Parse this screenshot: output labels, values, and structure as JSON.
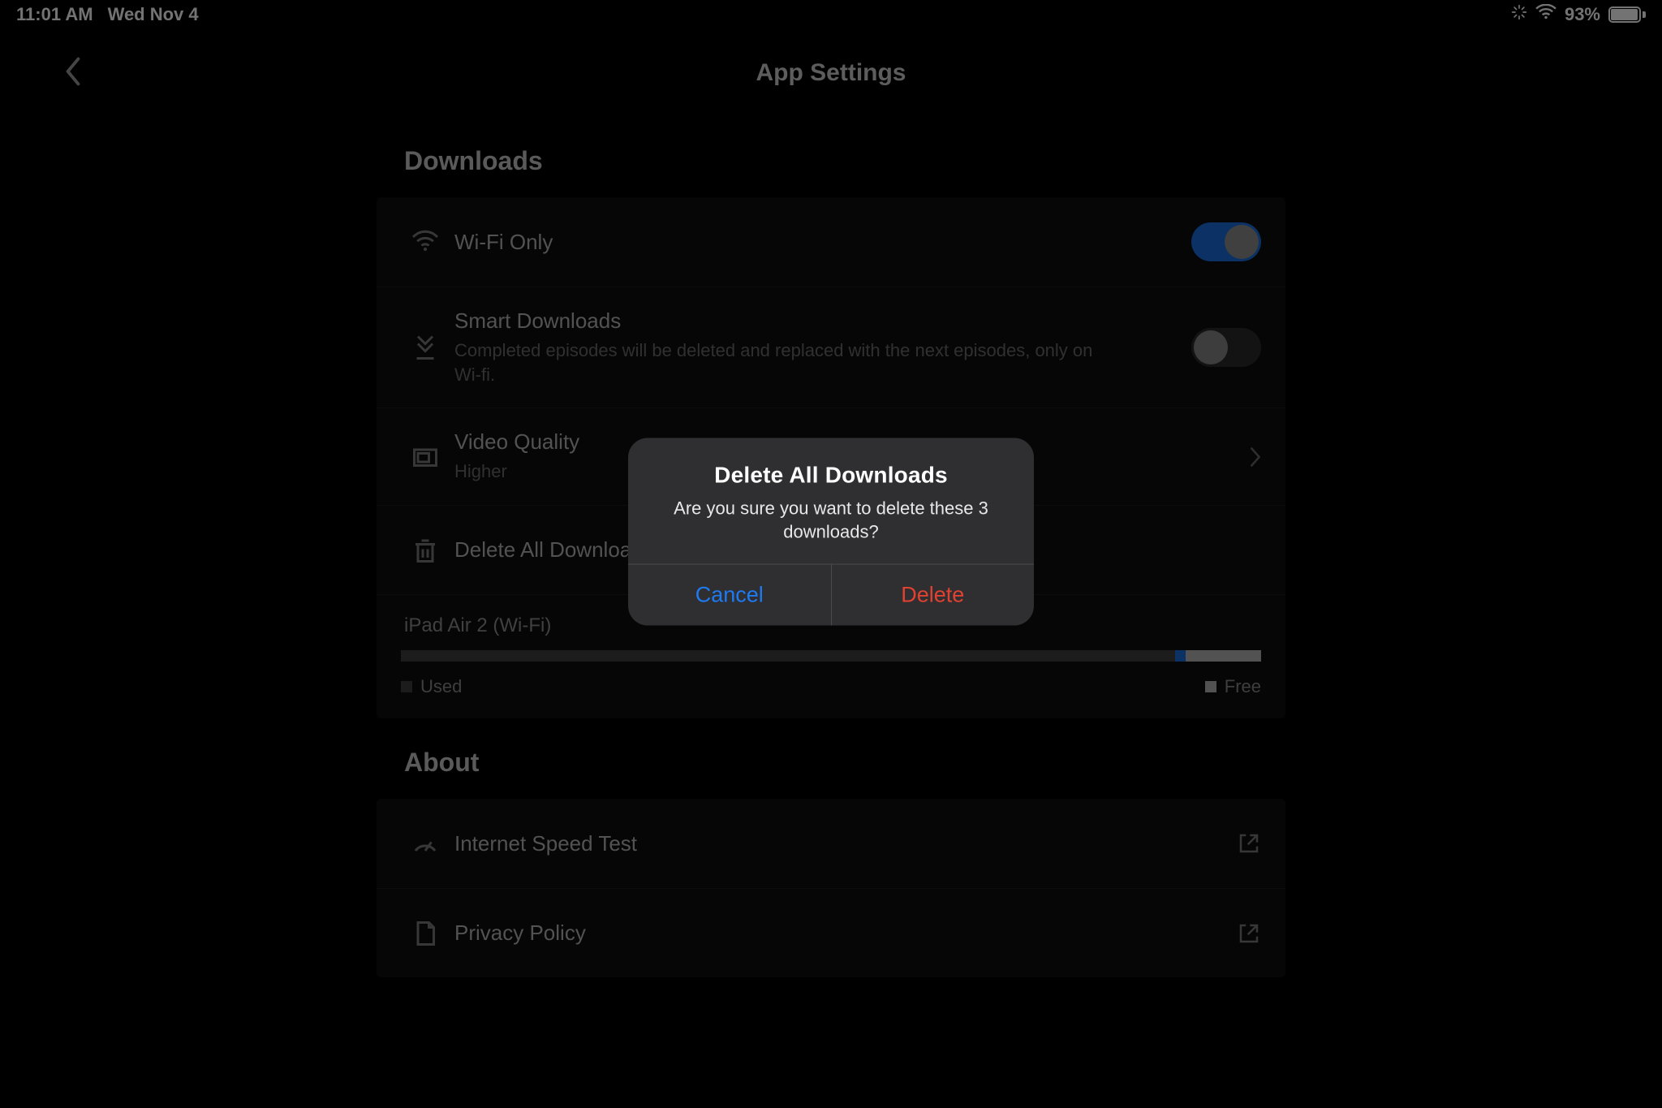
{
  "status": {
    "time": "11:01 AM",
    "date": "Wed Nov 4",
    "battery_percent": "93%"
  },
  "nav": {
    "title": "App Settings"
  },
  "sections": {
    "downloads_title": "Downloads",
    "about_title": "About"
  },
  "rows": {
    "wifi_only": {
      "label": "Wi-Fi Only",
      "state": "on"
    },
    "smart_downloads": {
      "label": "Smart Downloads",
      "sublabel": "Completed episodes will be deleted and replaced with the next episodes, only on Wi-fi.",
      "state": "off"
    },
    "video_quality": {
      "label": "Video Quality",
      "value": "Higher"
    },
    "delete_all": {
      "label": "Delete All Downloads"
    },
    "speed_test": {
      "label": "Internet Speed Test"
    },
    "privacy": {
      "label": "Privacy Policy"
    }
  },
  "storage": {
    "device": "iPad Air 2 (Wi-Fi)",
    "used_label": "Used",
    "free_label": "Free"
  },
  "alert": {
    "title": "Delete All Downloads",
    "message": "Are you sure you want to delete these 3 downloads?",
    "cancel": "Cancel",
    "delete": "Delete"
  }
}
